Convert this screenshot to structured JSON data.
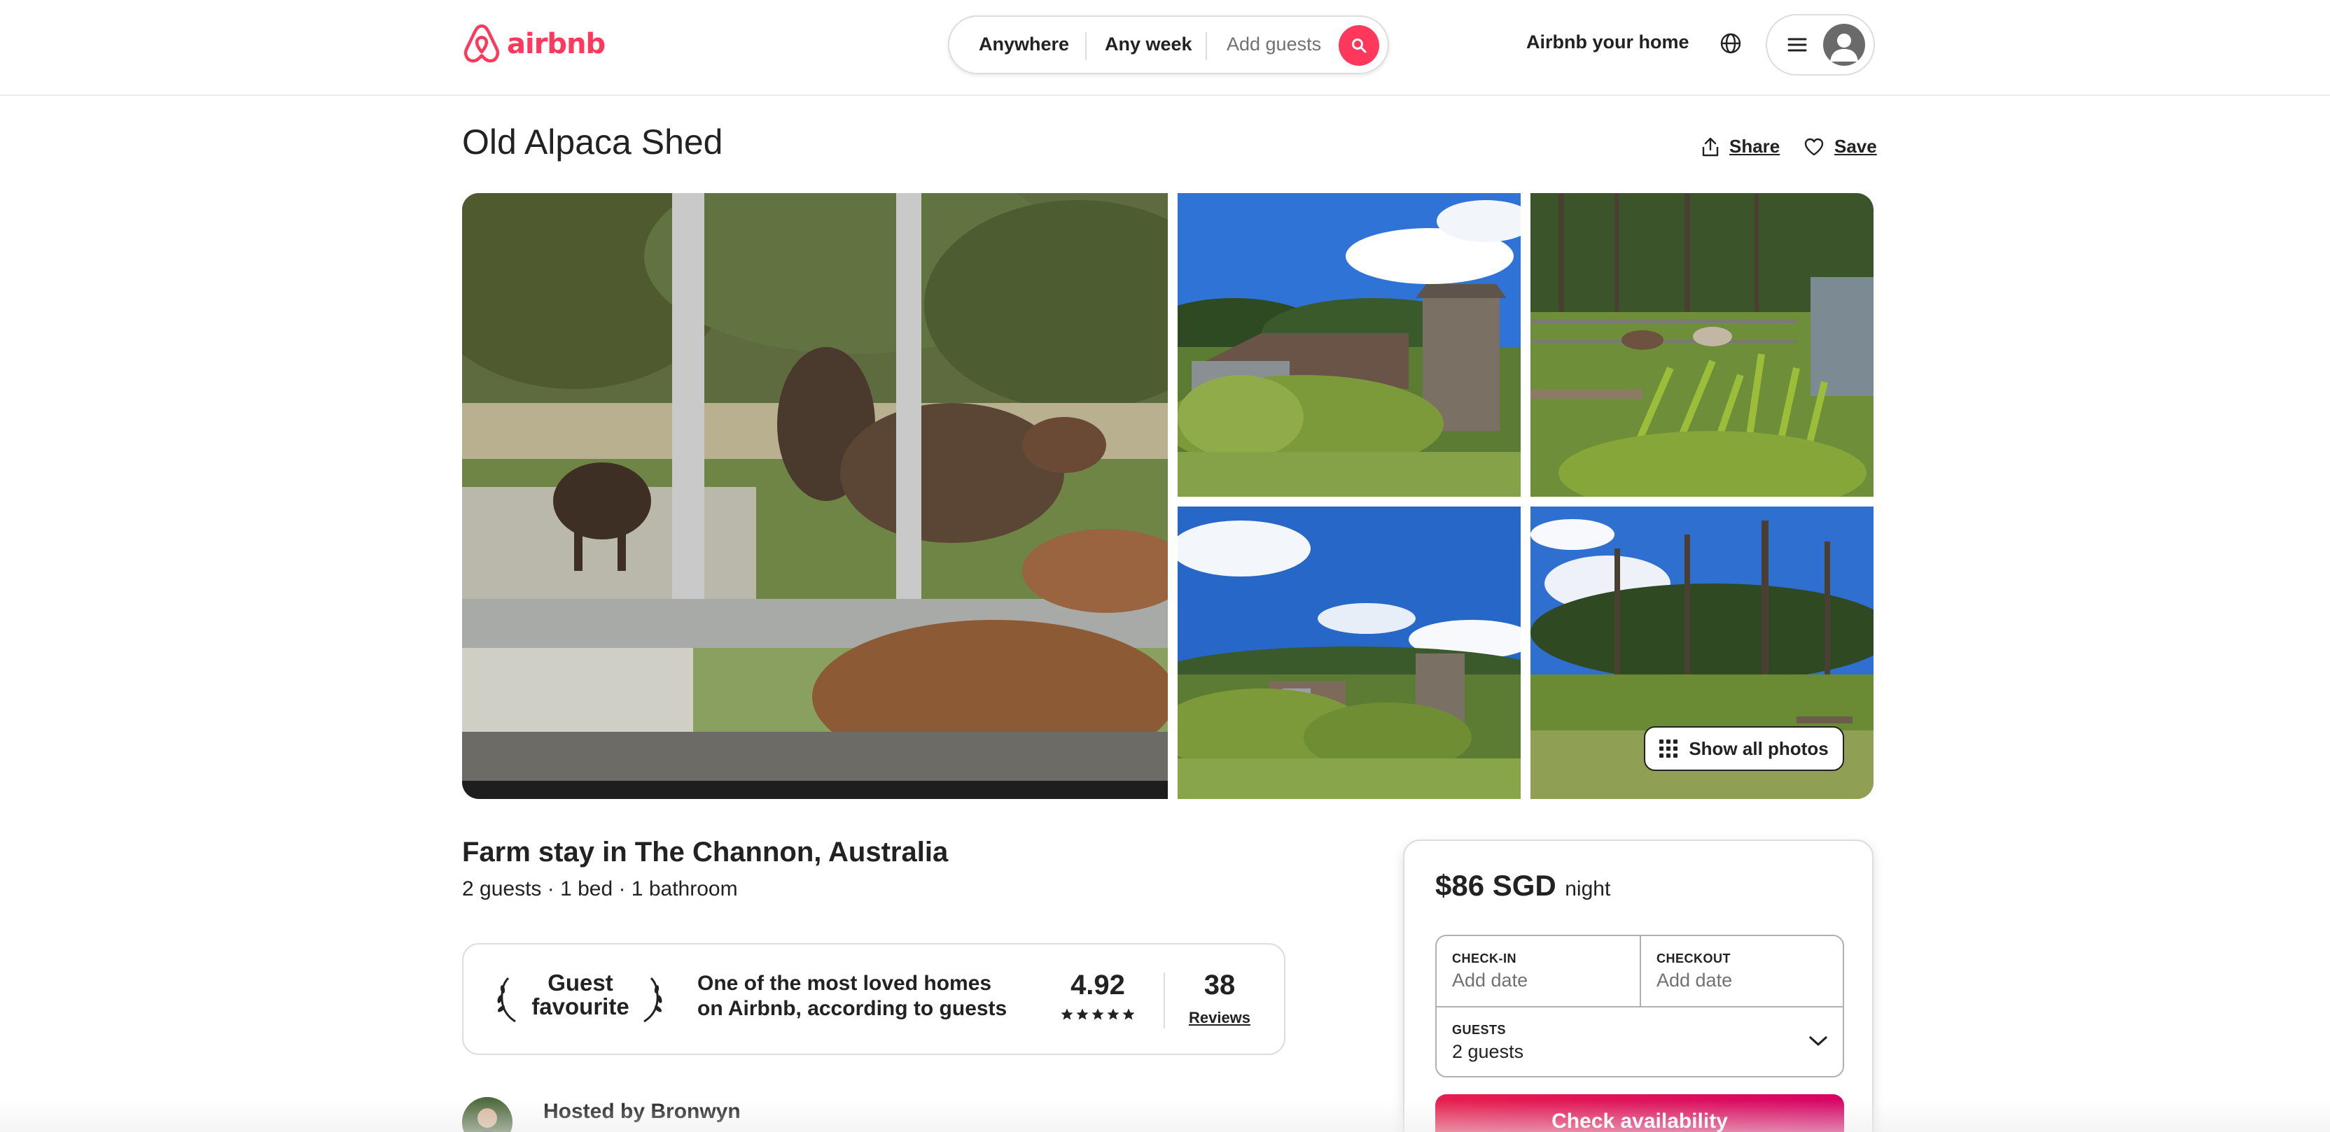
{
  "brand": {
    "name": "airbnb",
    "color": "#FF385C"
  },
  "search": {
    "location": "Anywhere",
    "week": "Any week",
    "guests_placeholder": "Add guests"
  },
  "header": {
    "host_link": "Airbnb your home"
  },
  "listing": {
    "title": "Old Alpaca Shed",
    "share_label": "Share",
    "save_label": "Save",
    "show_all_photos": "Show all photos",
    "subtitle": "Farm stay in The Channon, Australia",
    "details": "2 guests · 1 bed · 1 bathroom"
  },
  "guest_favourite": {
    "label_line1": "Guest",
    "label_line2": "favourite",
    "description": "One of the most loved homes on Airbnb, according to guests",
    "rating": "4.92",
    "stars": 5,
    "review_count": "38",
    "reviews_label": "Reviews"
  },
  "host": {
    "hosted_by": "Hosted by Bronwyn"
  },
  "booking": {
    "price": "$86 SGD",
    "price_unit": "night",
    "checkin_label": "CHECK-IN",
    "checkin_value": "Add date",
    "checkout_label": "CHECKOUT",
    "checkout_value": "Add date",
    "guests_label": "GUESTS",
    "guests_value": "2 guests",
    "cta_label": "Check availability"
  }
}
